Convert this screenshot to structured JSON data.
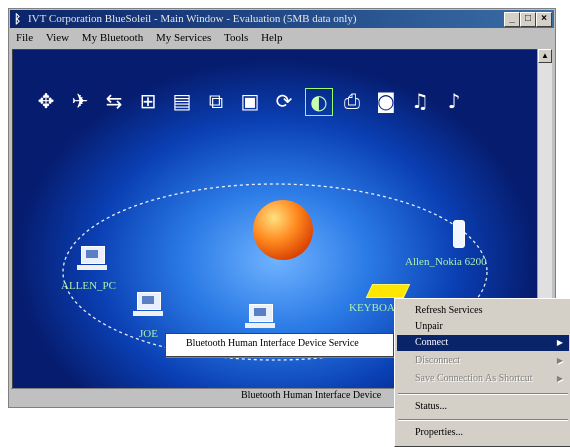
{
  "window": {
    "title": "IVT Corporation BlueSoleil - Main Window - Evaluation (5MB data only)",
    "icon": "bluetooth-icon",
    "buttons": {
      "minimize": "_",
      "maximize": "□",
      "close": "×"
    }
  },
  "menubar": {
    "items": [
      "File",
      "View",
      "My Bluetooth",
      "My Services",
      "Tools",
      "Help"
    ]
  },
  "toolbar": {
    "icons": [
      "dial-up-networking-icon",
      "fax-icon",
      "file-transfer-icon",
      "lan-access-icon",
      "object-push-icon",
      "personal-area-network-icon",
      "serial-port-icon",
      "sync-icon",
      "human-interface-device-icon",
      "printer-icon",
      "camera-icon",
      "headset-icon",
      "audio-gateway-icon"
    ],
    "selected_index": 8
  },
  "devices": {
    "allen_pc": "ALLEN_PC",
    "joe": "JOE",
    "nokia": "Allen_Nokia 6200",
    "keyboard": "KEYBOARD"
  },
  "popup": {
    "label": "Bluetooth Human Interface Device Service"
  },
  "status": {
    "text": "Bluetooth Human Interface Device"
  },
  "context_menu": {
    "items": [
      {
        "label": "Refresh Services",
        "state": "normal"
      },
      {
        "label": "Unpair",
        "state": "normal"
      },
      {
        "label": "Connect",
        "state": "highlighted",
        "submenu": true
      },
      {
        "label": "Disconnect",
        "state": "disabled",
        "submenu": true
      },
      {
        "label": "Save Connection As Shortcut",
        "state": "disabled",
        "submenu": true
      },
      {
        "label": "Status...",
        "state": "normal"
      },
      {
        "label": "Properties...",
        "state": "normal"
      }
    ]
  },
  "colors": {
    "title_bar": "#0a246a",
    "canvas_center": "#6fb2ff",
    "canvas_edge": "#061c6e",
    "device_label": "#aef0b0",
    "menu_highlight": "#0a246a"
  }
}
